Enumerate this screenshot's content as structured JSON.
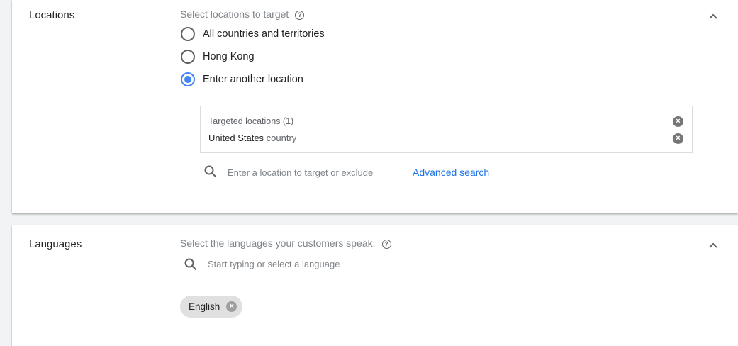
{
  "locations": {
    "title": "Locations",
    "prompt": "Select locations to target",
    "options": [
      {
        "label": "All countries and territories",
        "selected": false
      },
      {
        "label": "Hong Kong",
        "selected": false
      },
      {
        "label": "Enter another location",
        "selected": true
      }
    ],
    "targeted_header": "Targeted locations (1)",
    "targeted": [
      {
        "name": "United States",
        "type": "country"
      }
    ],
    "search_placeholder": "Enter a location to target or exclude",
    "advanced_search": "Advanced search"
  },
  "languages": {
    "title": "Languages",
    "prompt": "Select the languages your customers speak.",
    "search_placeholder": "Start typing or select a language",
    "chips": [
      "English"
    ]
  },
  "colors": {
    "accent": "#4285f4",
    "link": "#1a73e8",
    "background": "#f1f3f4"
  }
}
